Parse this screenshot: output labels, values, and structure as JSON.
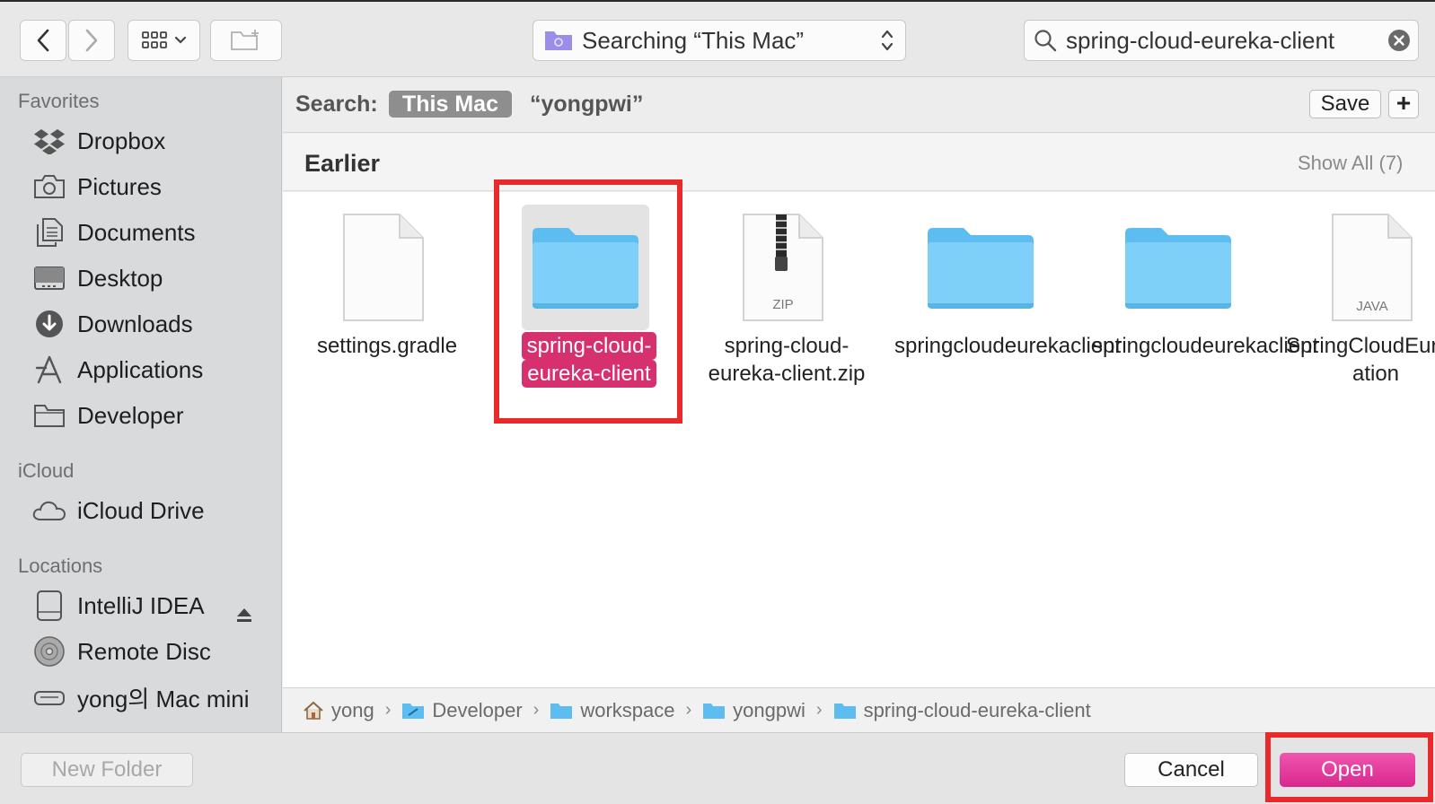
{
  "toolbar": {
    "location_label": "Searching “This Mac”",
    "search_value": "spring-cloud-eureka-client"
  },
  "sidebar": {
    "favorites_heading": "Favorites",
    "favorites": [
      {
        "label": "Dropbox",
        "icon": "dropbox-icon"
      },
      {
        "label": "Pictures",
        "icon": "camera-icon"
      },
      {
        "label": "Documents",
        "icon": "documents-icon"
      },
      {
        "label": "Desktop",
        "icon": "desktop-icon"
      },
      {
        "label": "Downloads",
        "icon": "download-icon"
      },
      {
        "label": "Applications",
        "icon": "applications-icon"
      },
      {
        "label": "Developer",
        "icon": "folder-icon"
      }
    ],
    "icloud_heading": "iCloud",
    "icloud": [
      {
        "label": "iCloud Drive",
        "icon": "cloud-icon"
      }
    ],
    "locations_heading": "Locations",
    "locations": [
      {
        "label": "IntelliJ IDEA",
        "icon": "disk-icon"
      },
      {
        "label": "Remote Disc",
        "icon": "disc-icon"
      },
      {
        "label": "yong의 Mac mini",
        "icon": "computer-icon"
      }
    ]
  },
  "scopebar": {
    "label": "Search:",
    "scope_this_mac": "This Mac",
    "scope_folder": "“yongpwi”",
    "save_label": "Save",
    "plus_label": "+"
  },
  "section": {
    "title": "Earlier",
    "show_all": "Show All (7)"
  },
  "files": [
    {
      "name": "settings.gradle",
      "kind": "document"
    },
    {
      "name": "spring-cloud-eureka-client",
      "kind": "folder",
      "selected": true
    },
    {
      "name": "spring-cloud-eureka-client.zip",
      "kind": "zip",
      "badge": "ZIP"
    },
    {
      "name": "springcloudeurekaclient",
      "kind": "folder"
    },
    {
      "name": "springcloudeurekaclient",
      "kind": "folder"
    },
    {
      "name": "SpringCloudEurekaClient…ation",
      "kind": "java",
      "badge": "JAVA"
    }
  ],
  "pathbar": {
    "crumbs": [
      "yong",
      "Developer",
      "workspace",
      "yongpwi",
      "spring-cloud-eureka-client"
    ]
  },
  "bottombar": {
    "new_folder_label": "New Folder",
    "cancel_label": "Cancel",
    "open_label": "Open"
  },
  "colors": {
    "selection": "#d6306f",
    "open_button": "#e23d9c",
    "highlight_box": "#e9292a",
    "folder_blue": "#5cc4f5"
  }
}
